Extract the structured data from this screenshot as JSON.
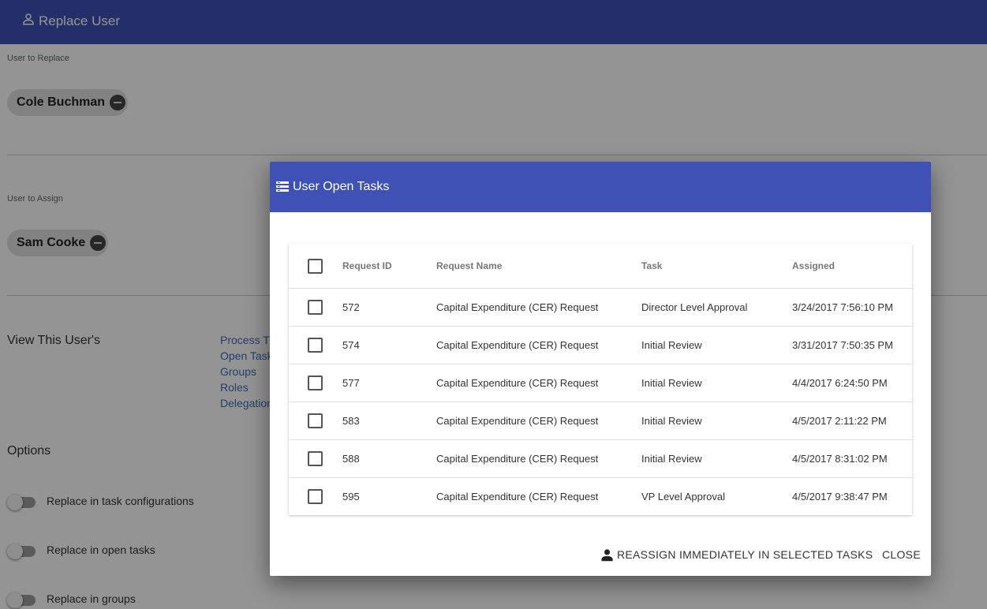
{
  "app": {
    "title": "Replace User",
    "header_color": "#3f51b5"
  },
  "user_to_replace": {
    "label": "User to Replace",
    "name": "Cole Buchman"
  },
  "user_to_assign": {
    "label": "User to Assign",
    "name": "Sam Cooke"
  },
  "view_section": {
    "title": "View This User's",
    "links": [
      "Process T",
      "Open Task",
      "Groups",
      "Roles",
      "Delegation"
    ]
  },
  "options": {
    "title": "Options",
    "toggles": [
      {
        "label": "Replace in task configurations",
        "on": false
      },
      {
        "label": "Replace in open tasks",
        "on": false
      },
      {
        "label": "Replace in groups",
        "on": false
      }
    ]
  },
  "dialog": {
    "title": "User Open Tasks",
    "columns": {
      "request_id": "Request ID",
      "request_name": "Request Name",
      "task": "Task",
      "assigned": "Assigned"
    },
    "rows": [
      {
        "id": "572",
        "name": "Capital Expenditure (CER) Request",
        "task": "Director Level Approval",
        "assigned": "3/24/2017 7:56:10 PM",
        "checked": false
      },
      {
        "id": "574",
        "name": "Capital Expenditure (CER) Request",
        "task": "Initial Review",
        "assigned": "3/31/2017 7:50:35 PM",
        "checked": false
      },
      {
        "id": "577",
        "name": "Capital Expenditure (CER) Request",
        "task": "Initial Review",
        "assigned": "4/4/2017 6:24:50 PM",
        "checked": false
      },
      {
        "id": "583",
        "name": "Capital Expenditure (CER) Request",
        "task": "Initial Review",
        "assigned": "4/5/2017 2:11:22 PM",
        "checked": false
      },
      {
        "id": "588",
        "name": "Capital Expenditure (CER) Request",
        "task": "Initial Review",
        "assigned": "4/5/2017 8:31:02 PM",
        "checked": false
      },
      {
        "id": "595",
        "name": "Capital Expenditure (CER) Request",
        "task": "VP Level Approval",
        "assigned": "4/5/2017 9:38:47 PM",
        "checked": false
      }
    ],
    "actions": {
      "reassign_label": "REASSIGN IMMEDIATELY IN SELECTED TASKS",
      "close_label": "CLOSE"
    }
  },
  "icons": {
    "app_title_icon": "person-outline-icon",
    "dialog_title_icon": "list-icon",
    "reassign_icon": "person-icon",
    "chip_remove_icon": "remove-circle-icon"
  }
}
